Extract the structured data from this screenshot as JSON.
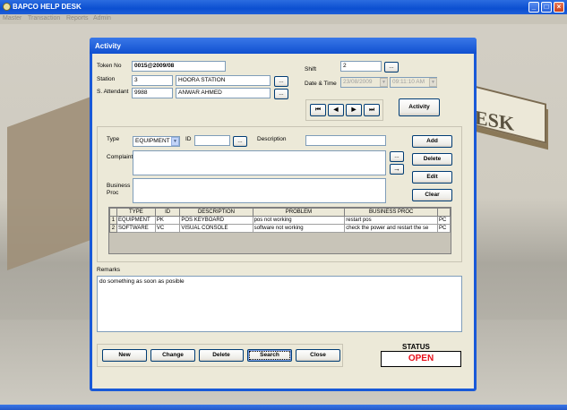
{
  "app": {
    "title": "BAPCO HELP DESK",
    "menu": [
      "Master",
      "Transaction",
      "Reports",
      "Admin"
    ],
    "background_sign": "ESK"
  },
  "dialog": {
    "title": "Activity",
    "token_label": "Token No",
    "token_value": "0015@2009/08",
    "station_label": "Station",
    "station_id": "3",
    "station_name": "HOORA STATION",
    "attendant_label": "S. Attendant",
    "attendant_id": "9988",
    "attendant_name": "ANWAR AHMED",
    "shift_label": "Shift",
    "shift_value": "2",
    "datetime_label": "Date & Time",
    "date_value": "23/08/2009",
    "time_value": "09:11:10 AM",
    "ellipsis": "...",
    "nav": {
      "first": "⏮",
      "prev": "◀",
      "next": "▶",
      "last": "⏭"
    },
    "activity_button": "Activity"
  },
  "entry": {
    "type_label": "Type",
    "type_value": "EQUIPMENT",
    "id_label": "ID",
    "id_value": "",
    "description_label": "Description",
    "description_value": "",
    "complaint_label": "Complaint",
    "complaint_value": "",
    "business_label_1": "Business",
    "business_label_2": "Proc",
    "business_value": "",
    "arrow_button": "→",
    "add_button": "Add",
    "delete_button": "Delete",
    "edit_button": "Edit",
    "clear_button": "Clear"
  },
  "grid": {
    "columns": [
      "TYPE",
      "ID",
      "DESCRIPTION",
      "PROBLEM",
      "BUSINESS PROC",
      ""
    ],
    "rows": [
      {
        "num": "1",
        "type": "EQUIPMENT",
        "id": "PK",
        "description": "POS KEYBOARD",
        "problem": "pos not working",
        "business": "restart pos",
        "extra": "PC"
      },
      {
        "num": "2",
        "type": "SOFTWARE",
        "id": "VC",
        "description": "VISUAL CONSOLE",
        "problem": "software not working",
        "business": "check the power and restart the se",
        "extra": "PC"
      }
    ]
  },
  "remarks": {
    "label": "Remarks",
    "value": "do something as soon as posible"
  },
  "actions": {
    "new": "New",
    "change": "Change",
    "delete": "Delete",
    "search": "Search",
    "close": "Close"
  },
  "status": {
    "label": "STATUS",
    "value": "OPEN",
    "color": "#e8101a"
  }
}
